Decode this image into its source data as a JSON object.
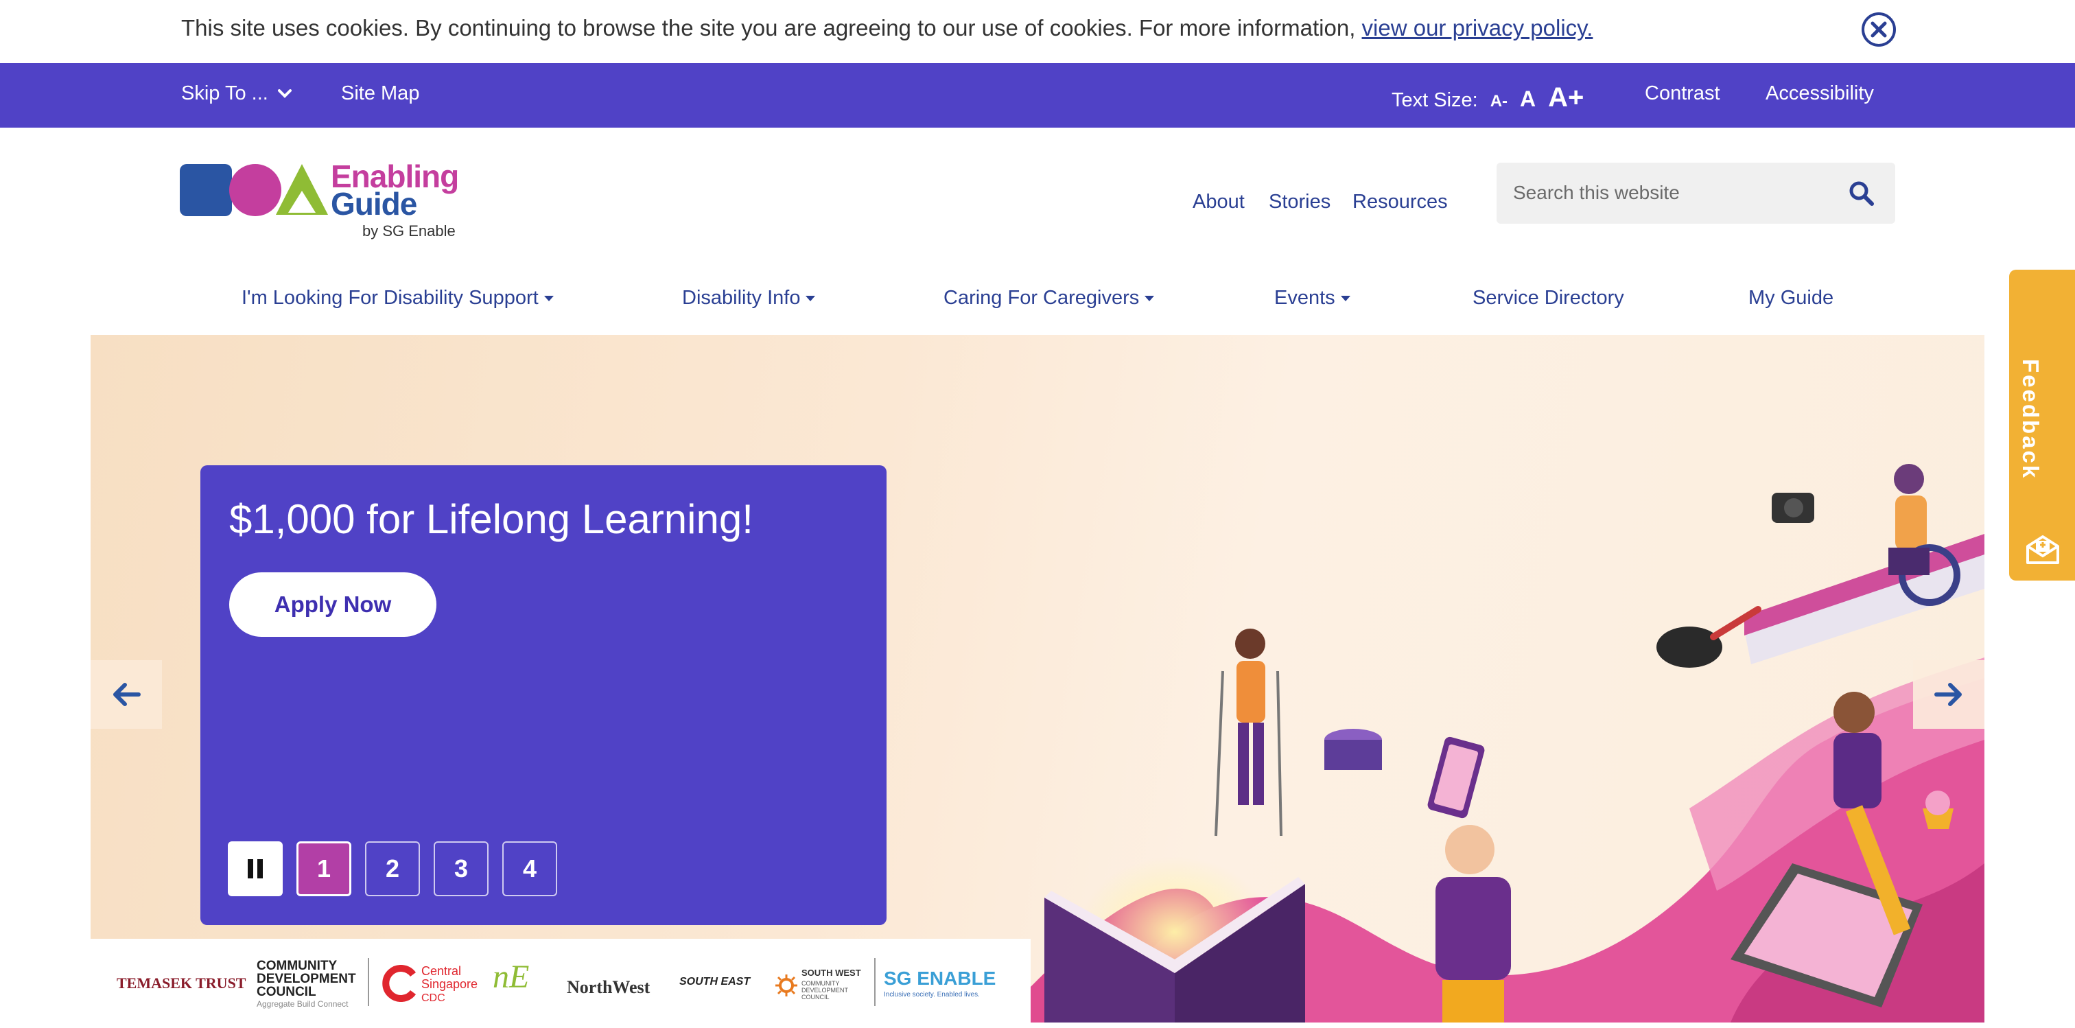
{
  "cookie": {
    "text": "This site uses cookies. By continuing to browse the site you are agreeing to our use of cookies. For more information, ",
    "link": "view our privacy policy."
  },
  "utility": {
    "skip": "Skip To ...",
    "sitemap": "Site Map",
    "textsize_label": "Text Size:",
    "ts_small": "A-",
    "ts_medium": "A",
    "ts_large": "A+",
    "contrast": "Contrast",
    "accessibility": "Accessibility"
  },
  "logo": {
    "line1": "Enabling",
    "line2": "Guide",
    "line3": "by SG Enable"
  },
  "topnav": {
    "about": "About",
    "stories": "Stories",
    "resources": "Resources"
  },
  "search": {
    "placeholder": "Search this website"
  },
  "mainnav": [
    "I'm Looking For Disability Support",
    "Disability Info",
    "Caring For Caregivers",
    "Events",
    "Service Directory",
    "My Guide"
  ],
  "hero": {
    "title": "$1,000 for Lifelong Learning!",
    "cta": "Apply Now",
    "pages": [
      "1",
      "2",
      "3",
      "4"
    ],
    "active_page": 1
  },
  "partners": {
    "temasek": "TEMASEK TRUST",
    "cdc": "COMMUNITY DEVELOPMENT COUNCIL",
    "cdc_sub": "Aggregate Build Connect",
    "central": "Central Singapore",
    "central_sub": "CDC",
    "ne": "nE",
    "northwest": "NorthWest",
    "southeast": "SOUTH EAST",
    "southwest": "SOUTH WEST",
    "southwest_sub": "COMMUNITY DEVELOPMENT COUNCIL",
    "sgenable": "SG ENABLE",
    "sgenable_sub": "Inclusive society. Enabled lives."
  },
  "feedback": {
    "label": "Feedback"
  },
  "colors": {
    "brand_purple": "#5042c6",
    "link_blue": "#2a3f93",
    "feedback_yellow": "#f2b134",
    "pagination_active": "#b23fa6"
  }
}
